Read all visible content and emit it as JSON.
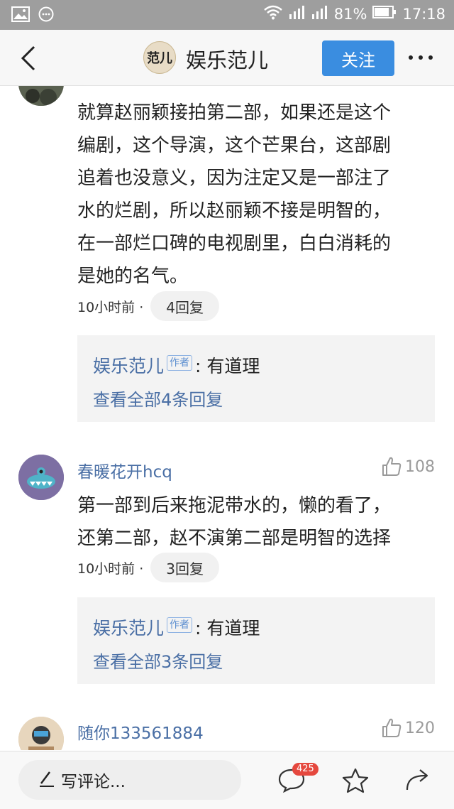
{
  "status_bar": {
    "battery": "81%",
    "time": "17:18"
  },
  "header": {
    "logo_text": "范儿",
    "title": "娱乐范儿",
    "follow_label": "关注"
  },
  "comments": [
    {
      "text_lines": [
        "就算赵丽颖接拍第二部，如果还是这个",
        "编剧，这个导演，这个芒果台，这部剧",
        "追着也没意义，因为注定又是一部注了",
        "水的烂剧，所以赵丽颖不接是明智的，",
        "在一部烂口碑的电视剧里，白白消耗的",
        "是她的名气。"
      ],
      "time": "10小时前 ·",
      "reply_label": "4回复",
      "author_reply": {
        "author": "娱乐范儿",
        "badge": "作者",
        "text": ": 有道理",
        "view_all": "查看全部4条回复"
      }
    },
    {
      "username": "春暖花开hcq",
      "likes": "108",
      "text_lines": [
        "第一部到后来拖泥带水的，懒的看了，",
        "还第二部，赵不演第二部是明智的选择"
      ],
      "time": "10小时前 ·",
      "reply_label": "3回复",
      "author_reply": {
        "author": "娱乐范儿",
        "badge": "作者",
        "text": ": 有道理",
        "view_all": "查看全部3条回复"
      }
    },
    {
      "username": "随你133561884",
      "likes": "120"
    }
  ],
  "bottom_bar": {
    "write_placeholder": "写评论...",
    "comment_count": "425"
  },
  "colors": {
    "accent": "#3a8de0",
    "link": "#4a6fa5",
    "badge_red": "#e5483e",
    "status_bar": "#9e9e9e"
  },
  "icons": [
    "image-icon",
    "message-icon",
    "wifi-icon",
    "signal-icon",
    "battery-icon",
    "back-arrow-icon",
    "more-icon",
    "thumb-up-icon",
    "pencil-icon",
    "comment-icon",
    "star-icon",
    "share-icon"
  ]
}
